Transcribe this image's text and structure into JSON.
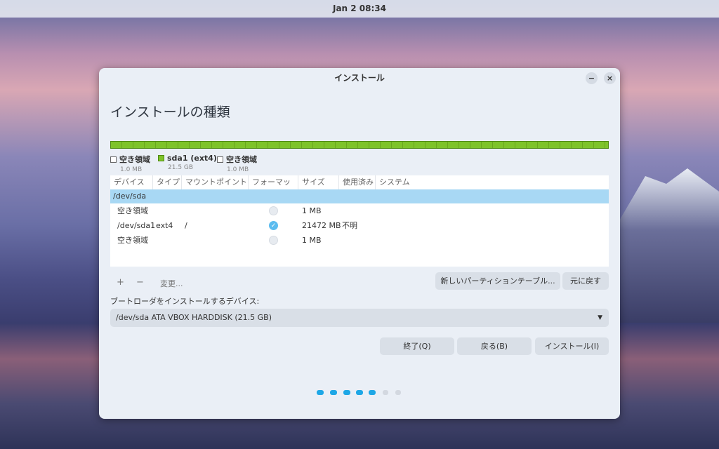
{
  "topbar": {
    "clock": "Jan 2  08:34"
  },
  "window": {
    "title": "インストール",
    "minimize": "−",
    "close": "×"
  },
  "page": {
    "heading": "インストールの種類"
  },
  "legend": [
    {
      "label": "空き領域",
      "size": "1.0 MB",
      "color": "#ffffff"
    },
    {
      "label": "sda1 (ext4)",
      "size": "21.5 GB",
      "color": "#7ec32a"
    },
    {
      "label": "空き領域",
      "size": "1.0 MB",
      "color": "#ffffff"
    }
  ],
  "table": {
    "headers": [
      "デバイス",
      "タイプ",
      "マウントポイント",
      "フォーマット",
      "サイズ",
      "使用済み",
      "システム"
    ],
    "disk": "/dev/sda",
    "rows": [
      {
        "device": "空き領域",
        "type": "",
        "mount": "",
        "format": false,
        "size": "1 MB",
        "used": ""
      },
      {
        "device": "/dev/sda1",
        "type": "ext4",
        "mount": "/",
        "format": true,
        "size": "21472 MB",
        "used": "不明"
      },
      {
        "device": "空き領域",
        "type": "",
        "mount": "",
        "format": false,
        "size": "1 MB",
        "used": ""
      }
    ]
  },
  "toolbar": {
    "add": "+",
    "remove": "−",
    "change": "変更...",
    "new_table": "新しいパーティションテーブル...",
    "revert": "元に戻す"
  },
  "bootloader": {
    "label": "ブートローダをインストールするデバイス:",
    "value": "/dev/sda  ATA VBOX HARDDISK (21.5 GB)"
  },
  "buttons": {
    "quit": "終了(Q)",
    "back": "戻る(B)",
    "install": "インストール(I)"
  },
  "progress": {
    "current_step": 5,
    "total_steps": 7
  }
}
